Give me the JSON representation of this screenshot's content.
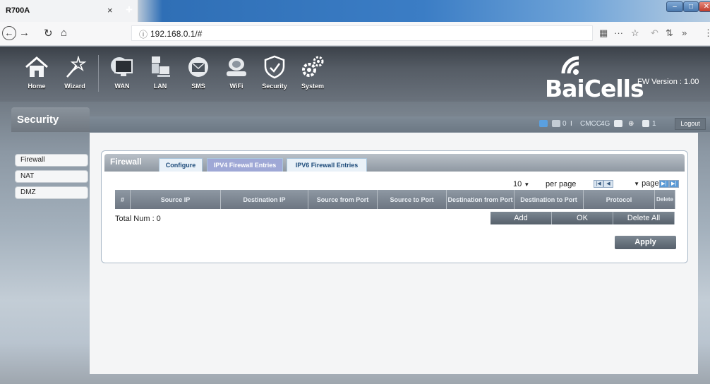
{
  "browser": {
    "tab_title": "R700A",
    "close_tab": "×",
    "new_tab": "+",
    "url": "192.168.0.1/#",
    "menu_dots": "···",
    "overflow": "»"
  },
  "header": {
    "menu": [
      {
        "label": "Home",
        "icon": "home-icon"
      },
      {
        "label": "Wizard",
        "icon": "wand-icon"
      },
      {
        "label": "WAN",
        "icon": "monitor-icon"
      },
      {
        "label": "LAN",
        "icon": "computer-icon"
      },
      {
        "label": "SMS",
        "icon": "envelope-icon"
      },
      {
        "label": "WiFi",
        "icon": "router-icon"
      },
      {
        "label": "Security",
        "icon": "shield-icon"
      },
      {
        "label": "System",
        "icon": "gears-icon"
      }
    ],
    "brand": "BaiCells",
    "fw_version": "FW Version : 1.00"
  },
  "section_title": "Security",
  "status": {
    "sms_count": "0",
    "operator": "CMCC",
    "network": "4G",
    "clients": "1",
    "logout": "Logout"
  },
  "sidebar": {
    "items": [
      {
        "label": "Firewall"
      },
      {
        "label": "NAT"
      },
      {
        "label": "DMZ"
      }
    ]
  },
  "content": {
    "panel_label": "Firewall",
    "tabs": [
      {
        "label": "Configure"
      },
      {
        "label": "IPV4 Firewall Entries"
      },
      {
        "label": "IPV6 Firewall Entries"
      }
    ],
    "per_page_value": "10",
    "per_page_label": "per page",
    "page_label": "page",
    "table_headers": [
      "#",
      "Source IP",
      "Destination IP",
      "Source from Port",
      "Source to Port",
      "Destination from Port",
      "Destination to Port",
      "Protocol",
      "Delete"
    ],
    "total": "Total Num : 0",
    "buttons": {
      "add": "Add",
      "ok": "OK",
      "delete_all": "Delete All"
    },
    "apply": "Apply"
  },
  "colors": {
    "accent_tab": "#9fa8d6",
    "header_bg": "#555c65"
  }
}
